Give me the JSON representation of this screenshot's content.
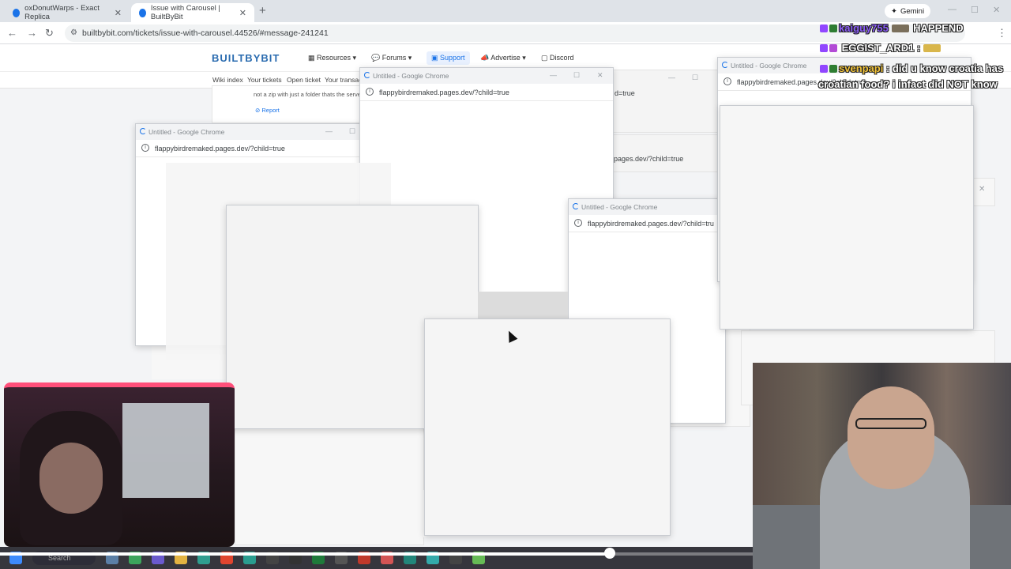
{
  "browser": {
    "tabs": [
      {
        "title": "oxDonutWarps - Exact Replica",
        "active": false
      },
      {
        "title": "Issue with Carousel | BuiltByBit",
        "active": true
      }
    ],
    "gemini_label": "Gemini",
    "url": "builtbybit.com/tickets/issue-with-carousel.44526/#message-241241"
  },
  "site": {
    "logo": "BUILTBYBIT",
    "nav": [
      "Resources",
      "Forums",
      "Support",
      "Advertise",
      "Discord"
    ],
    "subnav": [
      "Wiki index",
      "Your tickets",
      "Open ticket",
      "Your transac"
    ],
    "message_text": "not a zip with just a folder thats the serve",
    "report_label": "Report"
  },
  "popups": {
    "title": "Untitled - Google Chrome",
    "url": "flappybirdremaked.pages.dev/?child=true",
    "partial_urls": [
      "d=true",
      "pages.dev/?child=true",
      "flappybirdremaked.pages.dev/?child=tru",
      "flappybirdremaked.pages.dev/?child=true"
    ]
  },
  "chat": [
    {
      "user": "kaiguy755",
      "message": "HAPPEND",
      "user_color": "#8a5cf5"
    },
    {
      "user": "",
      "message": "EGGIST_ARD1 :",
      "user_color": "#ffffff"
    },
    {
      "user": "svenpapi",
      "message": ": did u know croatia has",
      "user_color": "#f0c23b"
    },
    {
      "user": "",
      "message": "croatian food? i infact did NOT know",
      "user_color": "#ffffff"
    }
  ],
  "taskbar": {
    "search_placeholder": "Search",
    "progress": 0.81
  },
  "colors": {
    "accent": "#1a73e8",
    "brand": "#2b6cb0"
  }
}
